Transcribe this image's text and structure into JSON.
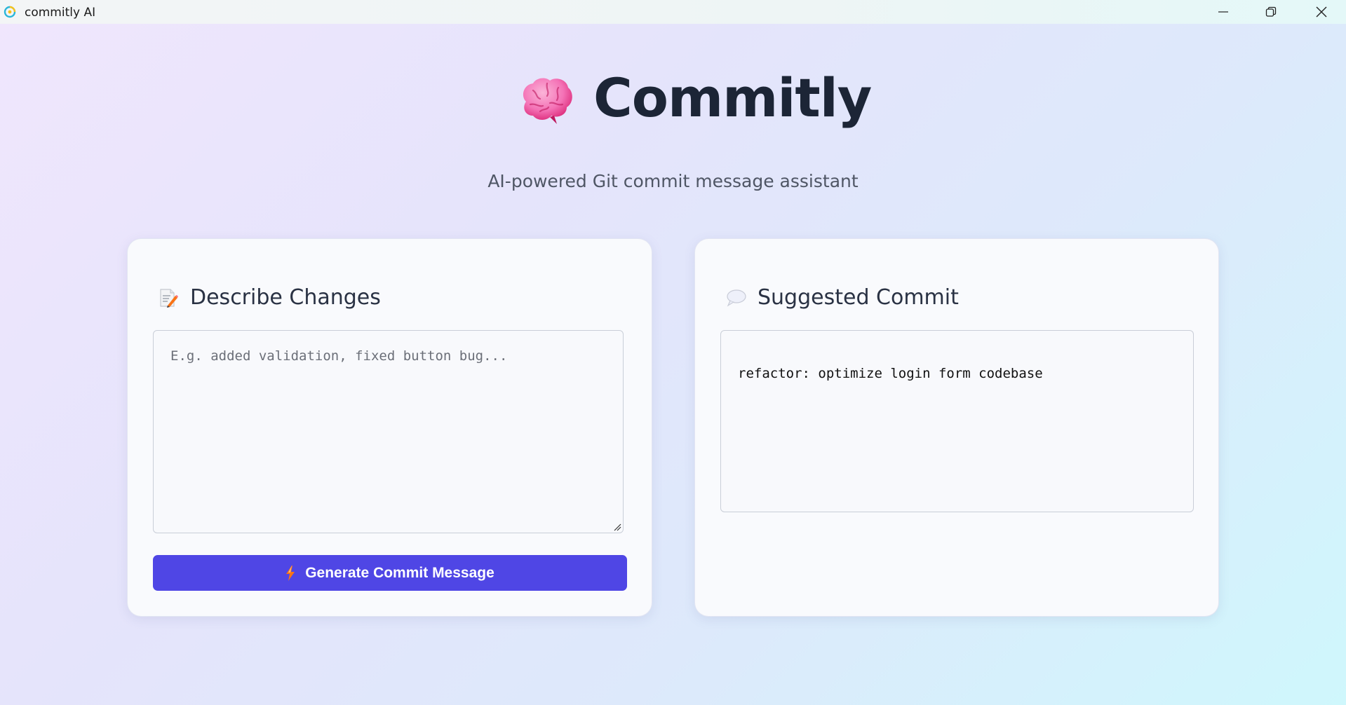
{
  "window": {
    "title": "commitly AI",
    "controls": {
      "minimize": "minimize",
      "maximize": "restore",
      "close": "close"
    }
  },
  "header": {
    "icon": "brain-icon",
    "title": "Commitly",
    "subtitle": "AI-powered Git commit message assistant"
  },
  "describe_panel": {
    "icon": "memo-icon",
    "heading": "Describe Changes",
    "input_placeholder": "E.g. added validation, fixed button bug...",
    "input_value": "",
    "button_icon": "lightning-icon",
    "button_label": "Generate Commit Message"
  },
  "suggest_panel": {
    "icon": "speech-bubble-icon",
    "heading": "Suggested Commit",
    "output": "refactor: optimize login form codebase"
  },
  "colors": {
    "accent": "#4f46e5",
    "heading": "#1c2536",
    "brain": "#f472b6"
  }
}
